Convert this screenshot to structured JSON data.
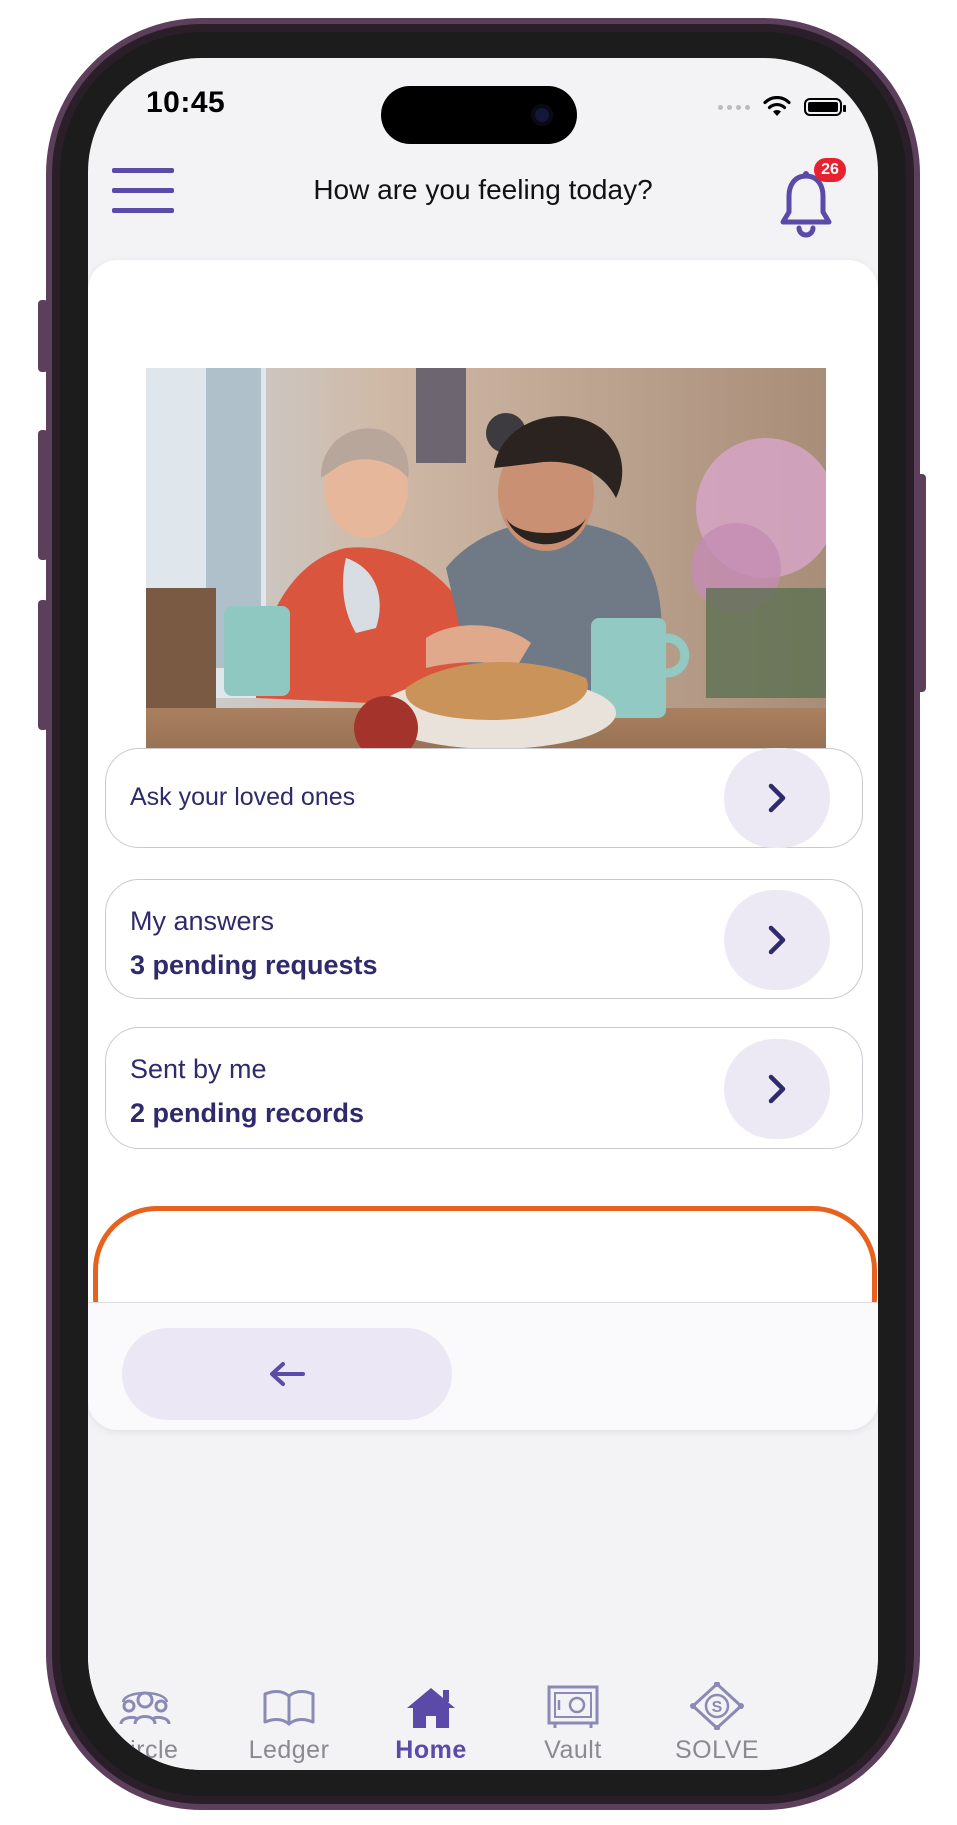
{
  "status_bar": {
    "time": "10:45"
  },
  "header": {
    "title": "How are you feeling today?",
    "notification_count": "26"
  },
  "options": [
    {
      "title": "Ask your loved ones",
      "subtitle": ""
    },
    {
      "title": "My answers",
      "subtitle": "3 pending requests"
    },
    {
      "title": "Sent by me",
      "subtitle": "2 pending records"
    }
  ],
  "tabs": [
    {
      "label": "Circle",
      "icon": "circle-people-icon",
      "active": false
    },
    {
      "label": "Ledger",
      "icon": "book-icon",
      "active": false
    },
    {
      "label": "Home",
      "icon": "home-icon",
      "active": true
    },
    {
      "label": "Vault",
      "icon": "vault-icon",
      "active": false
    },
    {
      "label": "SOLVE",
      "icon": "solve-icon",
      "active": false
    }
  ],
  "colors": {
    "accent": "#5b4aa8",
    "highlight": "#e8621f",
    "badge": "#e8212e",
    "text_dark": "#2e2a6b"
  }
}
